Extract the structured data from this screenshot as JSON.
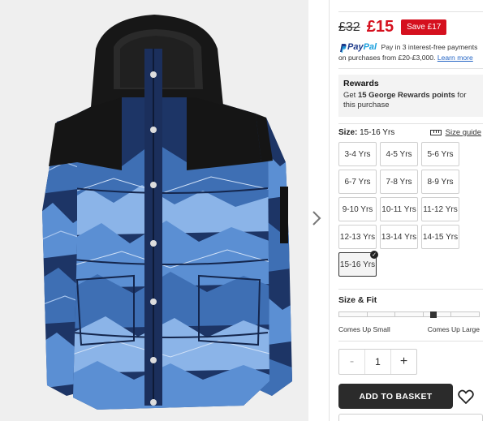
{
  "product_image": {
    "alt_icon": "puffer-jacket-image"
  },
  "price": {
    "old": "£32",
    "current": "£15",
    "save_badge": "Save £17",
    "accent_color": "#d5101e"
  },
  "paypal": {
    "logo_pay": "Pay",
    "logo_pal": "Pal",
    "text": "Pay in 3 interest-free payments on purchases from £20-£3,000.",
    "learn_more": "Learn more"
  },
  "rewards": {
    "title": "Rewards",
    "prefix": "Get ",
    "points": "15 George Rewards points",
    "suffix": " for this purchase"
  },
  "size": {
    "label": "Size:",
    "selected_value": "15-16 Yrs",
    "guide_label": "Size guide",
    "options": [
      "3-4 Yrs",
      "4-5 Yrs",
      "5-6 Yrs",
      "6-7 Yrs",
      "7-8 Yrs",
      "8-9 Yrs",
      "9-10 Yrs",
      "10-11 Yrs",
      "11-12 Yrs",
      "12-13 Yrs",
      "13-14 Yrs",
      "14-15 Yrs",
      "15-16 Yrs"
    ]
  },
  "fit": {
    "title": "Size & Fit",
    "low_label": "Comes Up Small",
    "high_label": "Comes Up Large",
    "segments": 5,
    "position": 0.67
  },
  "quantity": {
    "minus": "-",
    "value": "1",
    "plus": "+"
  },
  "cta": {
    "add_to_basket": "ADD TO BASKET"
  }
}
